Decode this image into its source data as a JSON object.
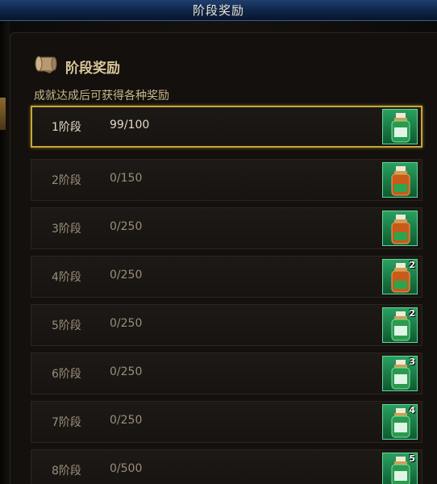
{
  "window": {
    "title": "阶段奖励"
  },
  "header": {
    "title": "阶段奖励",
    "icon": "scroll-icon"
  },
  "subtitle": "成就达成后可获得各种奖励",
  "stages": [
    {
      "label": "1阶段",
      "progress": "99/100",
      "reward_count": "",
      "active": true
    },
    {
      "label": "2阶段",
      "progress": "0/150",
      "reward_count": ""
    },
    {
      "label": "3阶段",
      "progress": "0/250",
      "reward_count": ""
    },
    {
      "label": "4阶段",
      "progress": "0/250",
      "reward_count": "2"
    },
    {
      "label": "5阶段",
      "progress": "0/250",
      "reward_count": "2"
    },
    {
      "label": "6阶段",
      "progress": "0/250",
      "reward_count": "3"
    },
    {
      "label": "7阶段",
      "progress": "0/250",
      "reward_count": "4"
    },
    {
      "label": "8阶段",
      "progress": "0/500",
      "reward_count": "5"
    }
  ],
  "colors": {
    "active_border": "#c8a53a",
    "slot_green": "#1e8a4e",
    "title_bar": "#16335c"
  }
}
